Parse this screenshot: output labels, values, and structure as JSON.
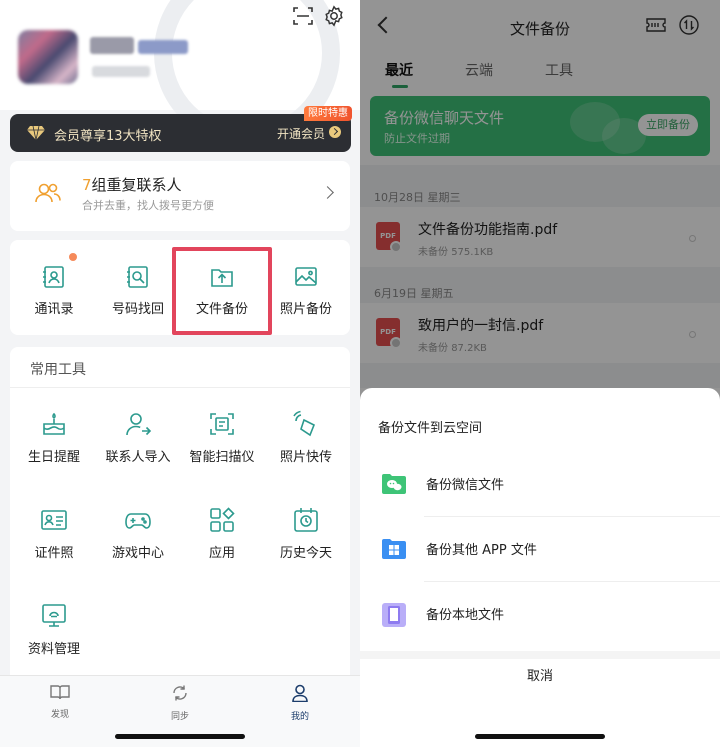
{
  "left": {
    "vip": {
      "text": "会员尊享13大特权",
      "open": "开通会员",
      "badge": "限时特惠"
    },
    "duplicates": {
      "count": "7",
      "title": "组重复联系人",
      "subtitle": "合并去重，找人拨号更方便"
    },
    "main_tools": [
      {
        "label": "通讯录",
        "icon": "contacts-icon"
      },
      {
        "label": "号码找回",
        "icon": "number-recovery-icon"
      },
      {
        "label": "文件备份",
        "icon": "file-backup-icon"
      },
      {
        "label": "照片备份",
        "icon": "photo-backup-icon"
      }
    ],
    "common": {
      "title": "常用工具",
      "tools": [
        {
          "label": "生日提醒",
          "icon": "birthday-cake-icon"
        },
        {
          "label": "联系人导入",
          "icon": "contact-import-icon"
        },
        {
          "label": "智能扫描仪",
          "icon": "scanner-icon"
        },
        {
          "label": "照片快传",
          "icon": "photo-transfer-icon"
        },
        {
          "label": "证件照",
          "icon": "id-photo-icon"
        },
        {
          "label": "游戏中心",
          "icon": "gamepad-icon"
        },
        {
          "label": "应用",
          "icon": "apps-icon"
        },
        {
          "label": "历史今天",
          "icon": "history-calendar-icon"
        },
        {
          "label": "资料管理",
          "icon": "data-management-icon"
        }
      ]
    },
    "tabbar": [
      {
        "label": "发现",
        "icon": "book-icon"
      },
      {
        "label": "同步",
        "icon": "sync-icon"
      },
      {
        "label": "我的",
        "icon": "user-icon"
      }
    ]
  },
  "right": {
    "title": "文件备份",
    "tabs": [
      "最近",
      "云端",
      "工具"
    ],
    "banner": {
      "title": "备份微信聊天文件",
      "subtitle": "防止文件过期",
      "button": "立即备份"
    },
    "groups": [
      {
        "date": "10月28日 星期三",
        "file": {
          "name": "文件备份功能指南.pdf",
          "status": "未备份",
          "size": "575.1KB"
        }
      },
      {
        "date": "6月19日 星期五",
        "file": {
          "name": "致用户的一封信.pdf",
          "status": "未备份",
          "size": "87.2KB"
        }
      }
    ],
    "sheet": {
      "title": "备份文件到云空间",
      "options": [
        {
          "label": "备份微信文件",
          "icon": "wechat-icon",
          "color": "#3ec477"
        },
        {
          "label": "备份其他 APP 文件",
          "icon": "app-grid-icon",
          "color": "#3a8ff2"
        },
        {
          "label": "备份本地文件",
          "icon": "tablet-icon",
          "color": "#8e7bf0"
        }
      ],
      "cancel": "取消"
    }
  },
  "colors": {
    "accent_green": "#3fc177",
    "highlight_red": "#e2455c",
    "icon_teal": "#2c9a8e"
  }
}
